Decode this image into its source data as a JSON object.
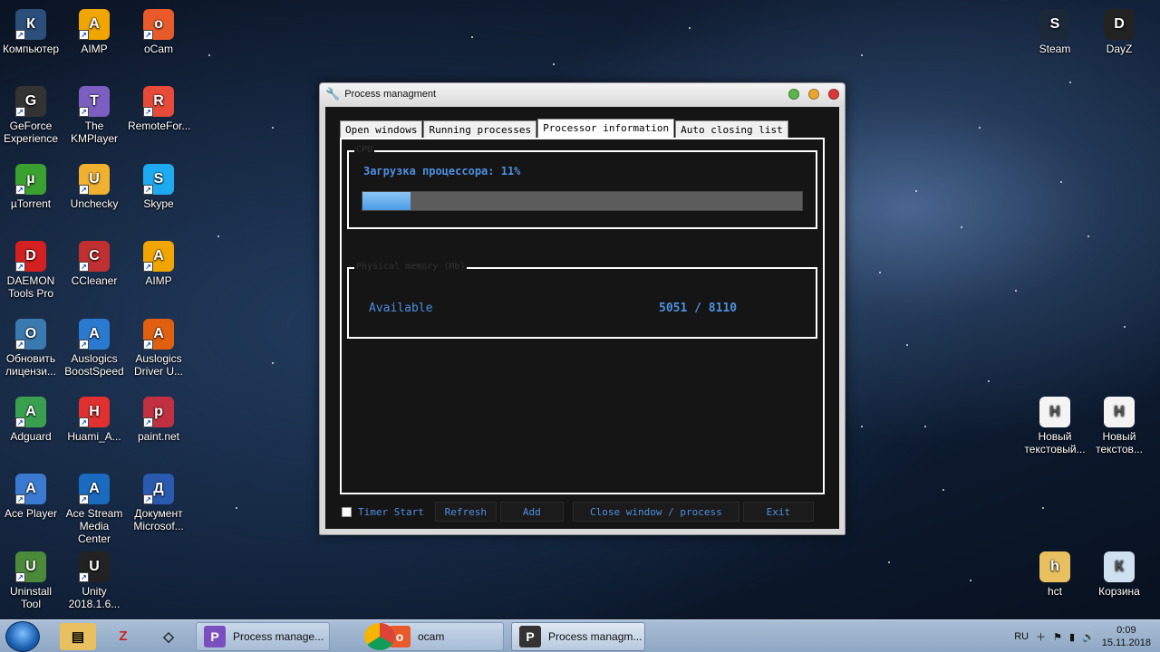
{
  "desktop": {
    "icons_left": [
      {
        "label": "Компьютер",
        "icon": "computer-icon",
        "color": "#2b4f7a"
      },
      {
        "label": "AIMP",
        "icon": "aimp-icon",
        "color": "#f0a500"
      },
      {
        "label": "oCam",
        "icon": "ocam-icon",
        "color": "#e85a2a"
      },
      {
        "label": "GeForce Experience",
        "icon": "geforce-icon",
        "color": "#333333"
      },
      {
        "label": "The KMPlayer",
        "icon": "kmplayer-icon",
        "color": "#7b5fc0"
      },
      {
        "label": "RemoteFor...",
        "icon": "remote-icon",
        "color": "#e84a3a"
      },
      {
        "label": "µTorrent",
        "icon": "utorrent-icon",
        "color": "#3aa030"
      },
      {
        "label": "Unchecky",
        "icon": "unchecky-icon",
        "color": "#f0b030"
      },
      {
        "label": "Skype",
        "icon": "skype-icon",
        "color": "#1eaaf0"
      },
      {
        "label": "DAEMON Tools Pro",
        "icon": "daemon-tools-icon",
        "color": "#d42020"
      },
      {
        "label": "CCleaner",
        "icon": "ccleaner-icon",
        "color": "#c03030"
      },
      {
        "label": "AIMP",
        "icon": "aimp-icon",
        "color": "#f0a500"
      },
      {
        "label": "Обновить лицензи...",
        "icon": "license-icon",
        "color": "#3a7ab0"
      },
      {
        "label": "Auslogics BoostSpeed",
        "icon": "boostspeed-icon",
        "color": "#2a7ad0"
      },
      {
        "label": "Auslogics Driver U...",
        "icon": "driver-updater-icon",
        "color": "#e06010"
      },
      {
        "label": "Adguard",
        "icon": "adguard-icon",
        "color": "#3aa050"
      },
      {
        "label": "Huami_A...",
        "icon": "huami-icon",
        "color": "#e03030"
      },
      {
        "label": "paint.net",
        "icon": "paintnet-icon",
        "color": "#c03040"
      },
      {
        "label": "Ace Player",
        "icon": "ace-player-icon",
        "color": "#3a7ad0"
      },
      {
        "label": "Ace Stream Media Center",
        "icon": "ace-stream-icon",
        "color": "#1a6ac0"
      },
      {
        "label": "Документ Microsof...",
        "icon": "word-doc-icon",
        "color": "#2a5ab0"
      },
      {
        "label": "Uninstall Tool",
        "icon": "uninstall-tool-icon",
        "color": "#4a8a3a"
      },
      {
        "label": "Unity 2018.1.6...",
        "icon": "unity-icon",
        "color": "#222222"
      }
    ],
    "icons_right": [
      {
        "label": "Steam",
        "icon": "steam-icon",
        "color": "#1b2838"
      },
      {
        "label": "DayZ",
        "icon": "dayz-icon",
        "color": "#222222"
      },
      {
        "label": "Новый текстовый...",
        "icon": "text-file-icon",
        "color": "#f4f4f4"
      },
      {
        "label": "Новый текстов...",
        "icon": "text-file-icon",
        "color": "#f4f4f4"
      },
      {
        "label": "hct",
        "icon": "folder-icon",
        "color": "#e8c060"
      },
      {
        "label": "Корзина",
        "icon": "recycle-bin-icon",
        "color": "#cfe0f0"
      }
    ]
  },
  "window": {
    "title": "Process managment",
    "tabs": [
      "Open windows",
      "Running processes",
      "Processor information",
      "Auto closing list"
    ],
    "active_tab": 2,
    "cpu_group_label": "CPU",
    "cpu_text": "Загрузка процессора: 11%",
    "cpu_load_fraction": 0.11,
    "memory_group_label": "Physical memory (Mb)",
    "memory_label": "Available",
    "memory_value": "5051 / 8110",
    "timer_label": "Timer Start",
    "buttons": {
      "refresh": "Refresh",
      "add": "Add",
      "close": "Close window / process",
      "exit": "Exit"
    }
  },
  "taskbar": {
    "items": [
      {
        "label": "Process manage...",
        "icon": "visual-studio-icon",
        "color": "#7b4fc0",
        "state": "pinned"
      },
      {
        "label": "ocam",
        "icon": "ocam-icon",
        "color": "#e85a2a",
        "state": "pinned"
      },
      {
        "label": "Process managm...",
        "icon": "wrench-icon",
        "color": "#333333",
        "state": "active"
      }
    ],
    "language": "RU",
    "time": "0:09",
    "date": "15.11.2018"
  },
  "colors": {
    "accent_text": "#4d90e0",
    "panel_bg": "#151515"
  }
}
